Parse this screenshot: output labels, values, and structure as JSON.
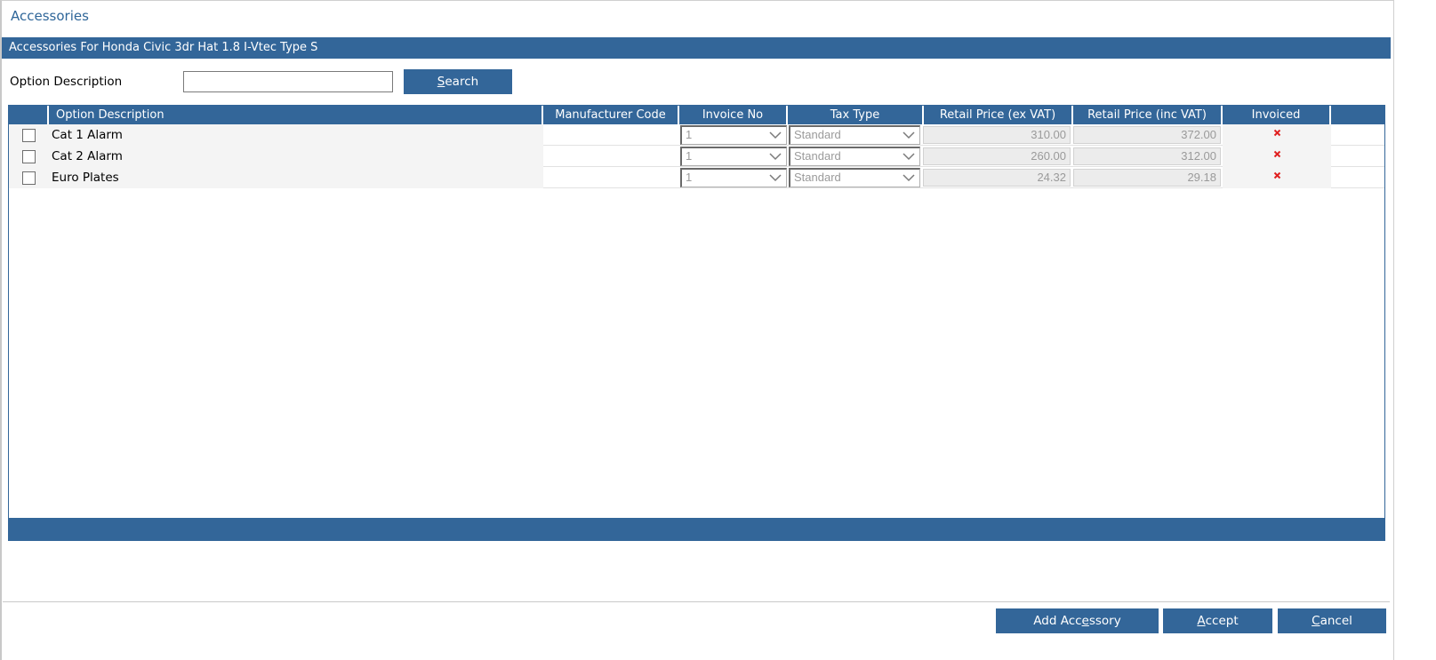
{
  "window": {
    "title": "Accessories"
  },
  "section": {
    "title": "Accessories For Honda Civic 3dr Hat 1.8 I-Vtec Type S"
  },
  "search": {
    "label": "Option Description",
    "value": "",
    "button_pre": "",
    "button_u": "S",
    "button_post": "earch"
  },
  "table": {
    "columns": {
      "description": "Option Description",
      "manufacturer_code": "Manufacturer Code",
      "invoice_no": "Invoice No",
      "tax_type": "Tax Type",
      "retail_ex_vat": "Retail Price (ex VAT)",
      "retail_inc_vat": "Retail Price (inc VAT)",
      "invoiced": "Invoiced"
    },
    "rows": [
      {
        "description": "Cat 1 Alarm",
        "manufacturer_code": "",
        "invoice_no": "1",
        "tax_type": "Standard",
        "retail_ex_vat": "310.00",
        "retail_inc_vat": "372.00",
        "invoiced": false
      },
      {
        "description": "Cat 2 Alarm",
        "manufacturer_code": "",
        "invoice_no": "1",
        "tax_type": "Standard",
        "retail_ex_vat": "260.00",
        "retail_inc_vat": "312.00",
        "invoiced": false
      },
      {
        "description": "Euro Plates",
        "manufacturer_code": "",
        "invoice_no": "1",
        "tax_type": "Standard",
        "retail_ex_vat": "24.32",
        "retail_inc_vat": "29.18",
        "invoiced": false
      }
    ]
  },
  "actions": {
    "add": {
      "pre": "Add Acc",
      "u": "e",
      "post": "ssory"
    },
    "accept": {
      "pre": "",
      "u": "A",
      "post": "ccept"
    },
    "cancel": {
      "pre": "",
      "u": "C",
      "post": "ancel"
    }
  },
  "colors": {
    "accent": "#336699",
    "title_text": "#2f6699",
    "invoiced_no": "#e02020"
  },
  "icons": {
    "invoiced_no": "red-x-icon",
    "dropdown": "chevron-down-icon"
  }
}
